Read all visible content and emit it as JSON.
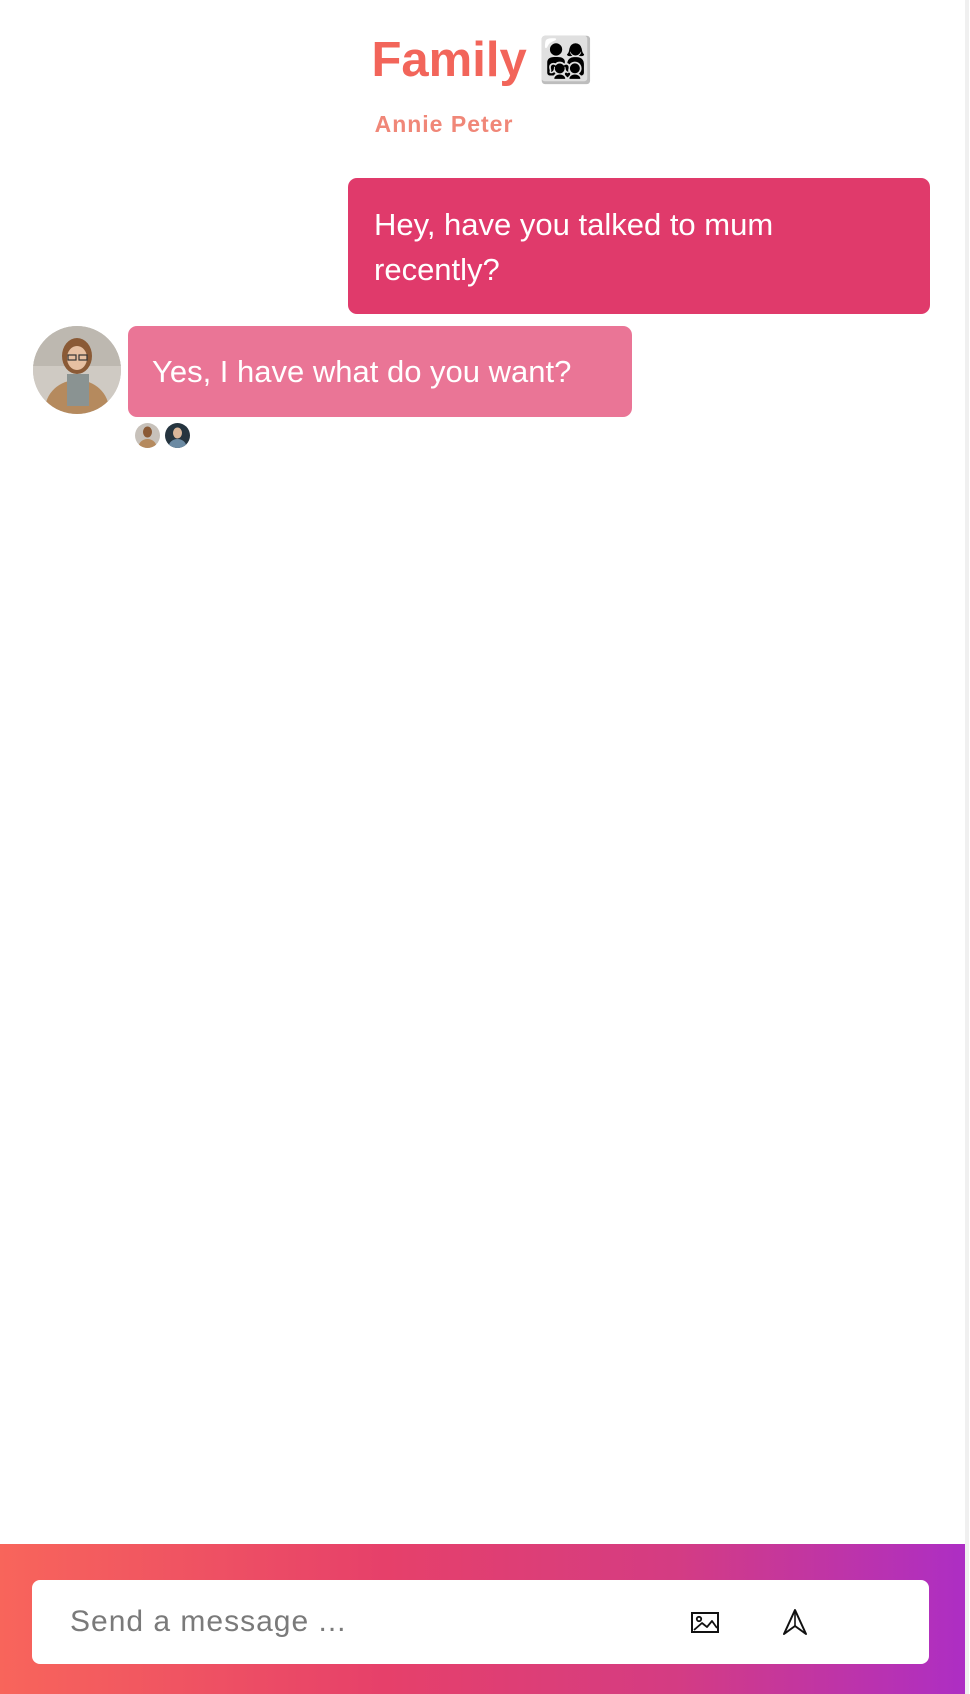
{
  "header": {
    "title": "Family",
    "title_emoji": "👨‍👩‍👧‍👦",
    "members": "Annie Peter"
  },
  "messages": [
    {
      "direction": "outgoing",
      "text": "Hey, have you talked to mum recently?"
    },
    {
      "direction": "incoming",
      "text": "Yes, I have what do you want?"
    }
  ],
  "composer": {
    "placeholder": "Send a message ...",
    "value": "",
    "icons": [
      "image-icon",
      "send-icon"
    ]
  },
  "colors": {
    "title": "#f2655a",
    "subtitle": "#f08778",
    "outgoing_bubble": "#e03a6b",
    "incoming_bubble": "#ea7596",
    "gradient_start": "#f8655b",
    "gradient_end": "#ad2ec4"
  }
}
